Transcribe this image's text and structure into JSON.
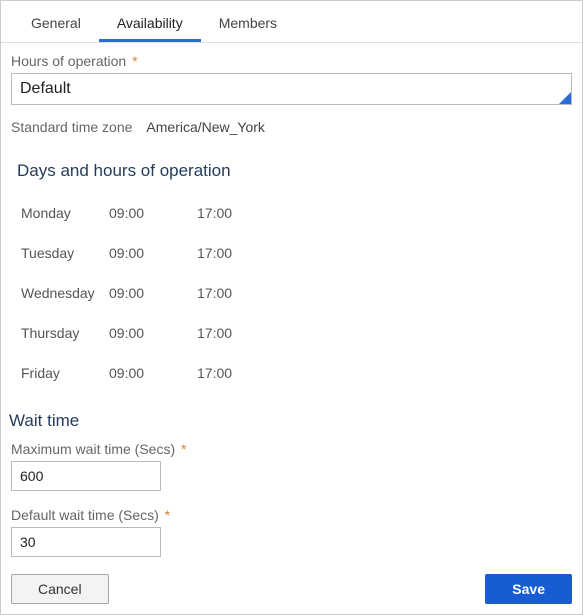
{
  "tabs": {
    "general": "General",
    "availability": "Availability",
    "members": "Members"
  },
  "hoursOfOperation": {
    "label": "Hours of operation",
    "value": "Default"
  },
  "timezone": {
    "label": "Standard time zone",
    "value": "America/New_York"
  },
  "daysSection": {
    "title": "Days and hours of operation",
    "rows": [
      {
        "day": "Monday",
        "start": "09:00",
        "end": "17:00"
      },
      {
        "day": "Tuesday",
        "start": "09:00",
        "end": "17:00"
      },
      {
        "day": "Wednesday",
        "start": "09:00",
        "end": "17:00"
      },
      {
        "day": "Thursday",
        "start": "09:00",
        "end": "17:00"
      },
      {
        "day": "Friday",
        "start": "09:00",
        "end": "17:00"
      }
    ]
  },
  "waitTime": {
    "title": "Wait time",
    "maxLabel": "Maximum wait time (Secs)",
    "maxValue": "600",
    "defaultLabel": "Default wait time (Secs)",
    "defaultValue": "30"
  },
  "buttons": {
    "cancel": "Cancel",
    "save": "Save"
  }
}
